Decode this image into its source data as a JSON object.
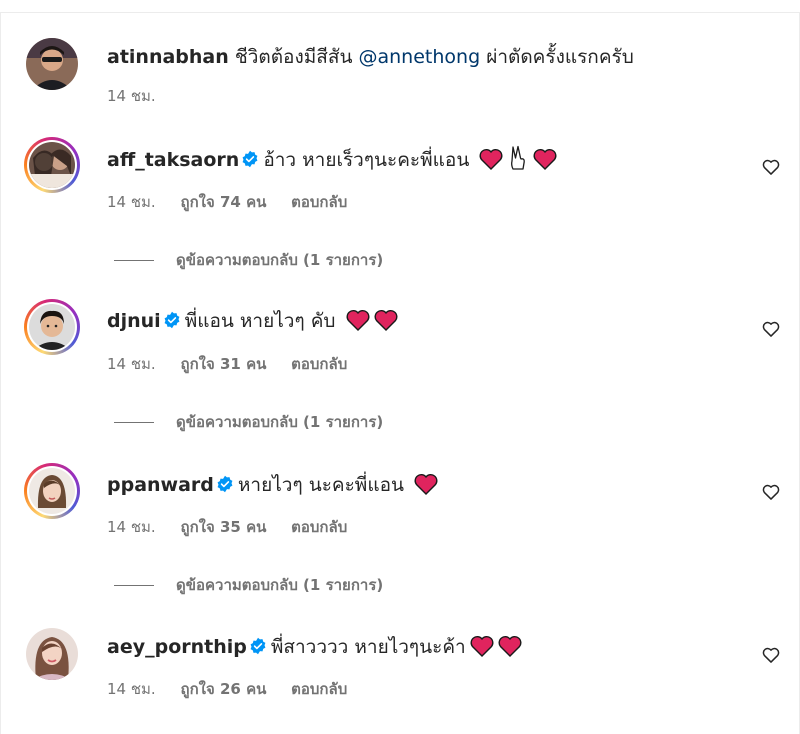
{
  "comments": [
    {
      "username": "atinnabhan",
      "verified": false,
      "text_before": "ชีวิตต้องมีสีสัน",
      "mention": "@annethong",
      "text_after": "ผ่าตัดครั้งแรกครับ",
      "time": "14 ชม.",
      "likes": "",
      "reply": "",
      "view_replies": "",
      "emojis": []
    },
    {
      "username": "aff_taksaorn",
      "verified": true,
      "text": "อ้าว หายเร็วๆนะคะพี่แอน",
      "emojis": [
        "heart",
        "victory-hand",
        "heart"
      ],
      "time": "14 ชม.",
      "likes": "ถูกใจ 74 คน",
      "reply": "ตอบกลับ",
      "view_replies": "ดูข้อความตอบกลับ (1 รายการ)"
    },
    {
      "username": "djnui",
      "verified": true,
      "text": "พี่แอน หายไวๆ คับ",
      "emojis": [
        "heart",
        "heart"
      ],
      "time": "14 ชม.",
      "likes": "ถูกใจ 31 คน",
      "reply": "ตอบกลับ",
      "view_replies": "ดูข้อความตอบกลับ (1 รายการ)"
    },
    {
      "username": "ppanward",
      "verified": true,
      "text": "หายไวๆ นะคะพี่แอน",
      "emojis": [
        "heart"
      ],
      "time": "14 ชม.",
      "likes": "ถูกใจ 35 คน",
      "reply": "ตอบกลับ",
      "view_replies": "ดูข้อความตอบกลับ (1 รายการ)"
    },
    {
      "username": "aey_pornthip",
      "verified": true,
      "text": "พี่สาวววว หายไวๆนะค้า",
      "emojis": [
        "heart",
        "heart"
      ],
      "time": "14 ชม.",
      "likes": "ถูกใจ 26 คน",
      "reply": "ตอบกลับ",
      "view_replies": ""
    }
  ],
  "colors": {
    "text": "#262626",
    "muted": "#737373",
    "mention": "#00376b",
    "verified": "#0095f6",
    "heart_emoji": "#e0245e"
  }
}
